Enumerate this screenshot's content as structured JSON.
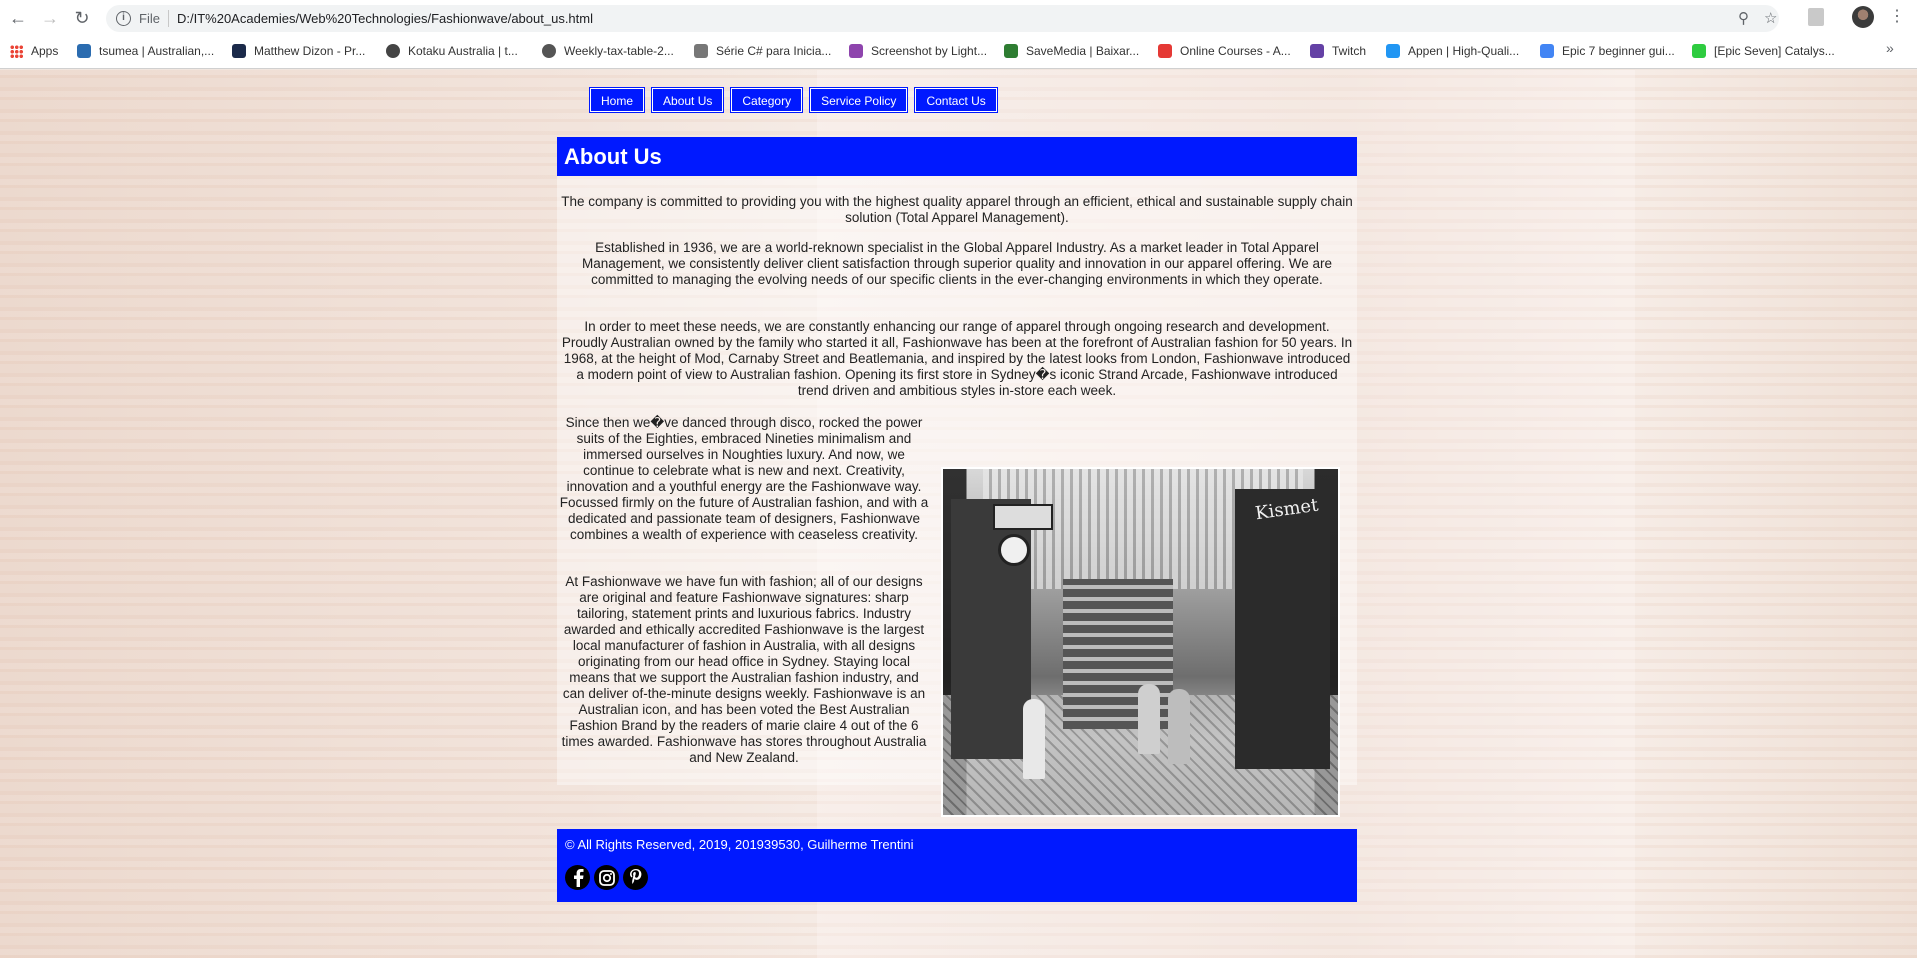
{
  "browser": {
    "scheme": "File",
    "url": "D:/IT%20Academies/Web%20Technologies/Fashionwave/about_us.html",
    "bookmarks": [
      {
        "label": "Apps",
        "color": "#ea4335"
      },
      {
        "label": "tsumea | Australian,...",
        "color": "#2b6cb0"
      },
      {
        "label": "Matthew Dizon - Pr...",
        "color": "#1b2a4a"
      },
      {
        "label": "Kotaku Australia | t...",
        "color": "#444444"
      },
      {
        "label": "Weekly-tax-table-2...",
        "color": "#555555"
      },
      {
        "label": "Série C# para Inicia...",
        "color": "#777777"
      },
      {
        "label": "Screenshot by Light...",
        "color": "#8e44ad"
      },
      {
        "label": "SaveMedia | Baixar...",
        "color": "#2e7d32"
      },
      {
        "label": "Online Courses - A...",
        "color": "#e53935"
      },
      {
        "label": "Twitch",
        "color": "#6441a5"
      },
      {
        "label": "Appen | High-Quali...",
        "color": "#2196f3"
      },
      {
        "label": "Epic 7 beginner gui...",
        "color": "#4285f4"
      },
      {
        "label": "[Epic Seven] Catalys...",
        "color": "#2ecc40"
      }
    ]
  },
  "nav": {
    "items": [
      "Home",
      "About Us",
      "Category",
      "Service Policy",
      "Contact Us"
    ]
  },
  "main": {
    "title": "About Us",
    "paragraphs": [
      "The company is committed to providing you with the highest quality apparel through an efficient, ethical and sustainable supply chain solution (Total Apparel Management).",
      "Established in 1936, we are a world-reknown specialist in the Global Apparel Industry. As a market leader in Total Apparel Management, we consistently deliver client satisfaction through superior quality and innovation in our apparel offering. We are committed to managing the evolving needs of our specific clients in the ever-changing environments in which they operate.",
      "In order to meet these needs, we are constantly enhancing our range of apparel through ongoing research and development. Proudly Australian owned by the family who started it all, Fashionwave has been at the forefront of Australian fashion for 50 years. In 1968, at the height of Mod, Carnaby Street and Beatlemania, and inspired by the latest looks from London, Fashionwave introduced a modern point of view to Australian fashion. Opening its first store in Sydney�s iconic Strand Arcade, Fashionwave introduced trend driven and ambitious styles in-store each week.",
      "Since then we�ve danced through disco, rocked the power suits of the Eighties, embraced Nineties minimalism and immersed ourselves in Noughties luxury. And now, we continue to celebrate what is new and next. Creativity, innovation and a youthful energy are the Fashionwave way. Focussed firmly on the future of Australian fashion, and with a dedicated and passionate team of designers, Fashionwave combines a wealth of experience with ceaseless creativity.",
      "At Fashionwave we have fun with fashion; all of our designs are original and feature Fashionwave signatures: sharp tailoring, statement prints and luxurious fabrics. Industry awarded and ethically accredited Fashionwave is the largest local manufacturer of fashion in Australia, with all designs originating from our head office in Sydney. Staying local means that we support the Australian fashion industry, and can deliver of-the-minute designs weekly. Fashionwave is an Australian icon, and has been voted the Best Australian Fashion Brand by the readers of marie claire 4 out of the 6 times awarded. Fashionwave has stores throughout Australia and New Zealand."
    ],
    "photo_sign": "Kismet"
  },
  "footer": {
    "copyright": "© All Rights Reserved, 2019, 201939530, Guilherme Trentini",
    "social": [
      "facebook",
      "instagram",
      "pinterest"
    ]
  },
  "colors": {
    "accent": "#0019ff"
  }
}
